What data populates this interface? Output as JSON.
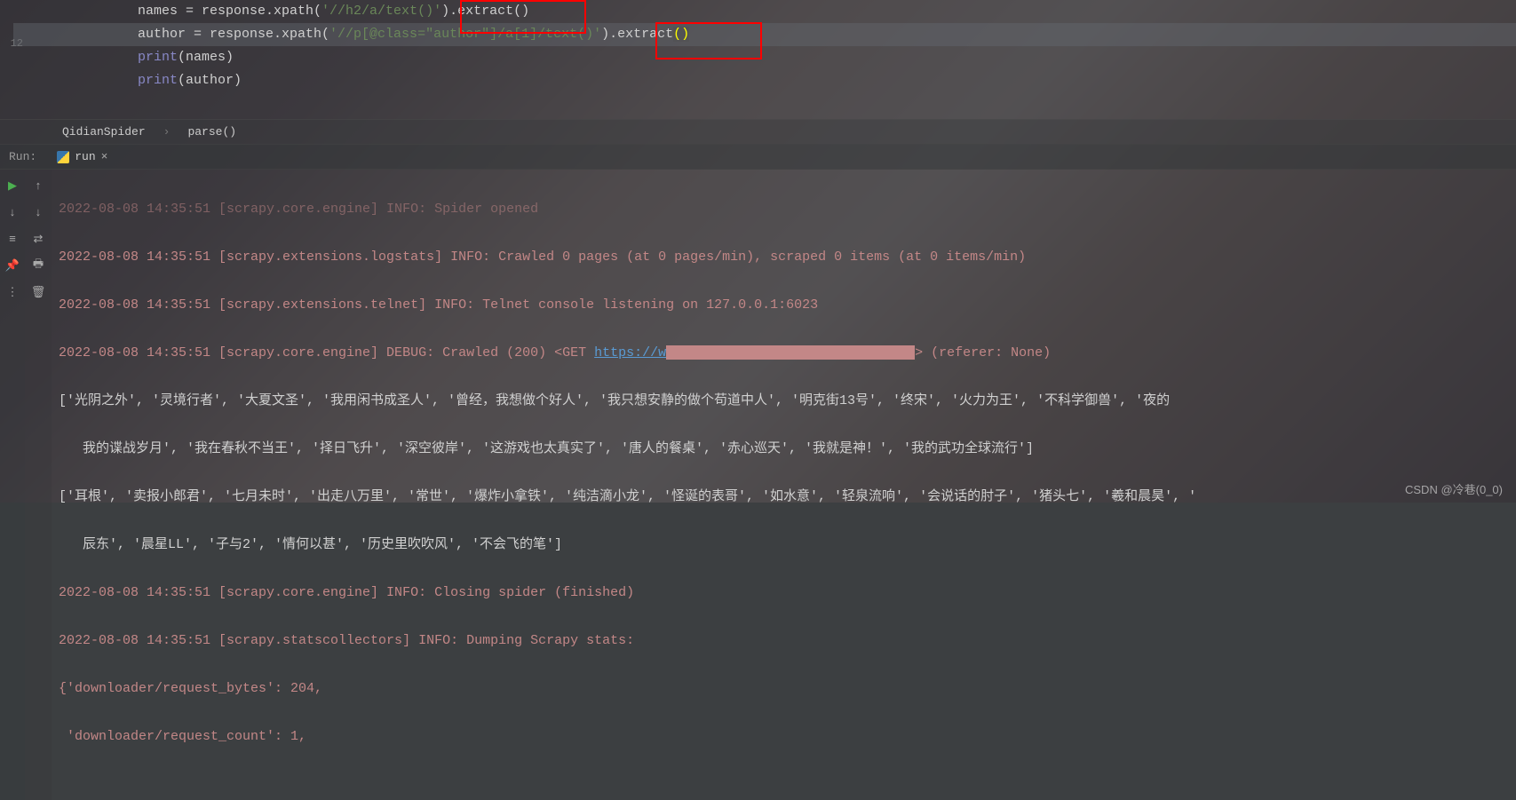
{
  "editor": {
    "gutter_line_12": "12",
    "line1": {
      "var": "names",
      "eq": " = response.xpath(",
      "str": "'//h2/a/text()'",
      "tail": ").extract()"
    },
    "line2": {
      "var": "author",
      "eq": " = response.xpath(",
      "str": "'//p[@class=\"author\"]/a[1]/text()'",
      "tail_a": ").extract",
      "paren_open": "(",
      "paren_close": ")"
    },
    "line3": {
      "print": "print",
      "args": "(names)"
    },
    "line4": {
      "print": "print",
      "args": "(author)"
    }
  },
  "breadcrumb": {
    "item1": "QidianSpider",
    "item2": "parse()"
  },
  "run": {
    "label": "Run:",
    "tab": "run",
    "close": "×"
  },
  "console": {
    "partial_top": "2022-08-08 14:35:51 [scrapy.core.engine] INFO: Spider opened",
    "l1": "2022-08-08 14:35:51 [scrapy.extensions.logstats] INFO: Crawled 0 pages (at 0 pages/min), scraped 0 items (at 0 items/min)",
    "l2": "2022-08-08 14:35:51 [scrapy.extensions.telnet] INFO: Telnet console listening on 127.0.0.1:6023",
    "l3_pre": "2022-08-08 14:35:51 [scrapy.core.engine] DEBUG: Crawled (200) <GET ",
    "l3_url": "https://w",
    "l3_post": "> (referer: None)",
    "names_list": "['光阴之外', '灵境行者', '大夏文圣', '我用闲书成圣人', '曾经，我想做个好人', '我只想安静的做个苟道中人', '明克街13号', '终宋', '火力为王', '不科学御兽', '夜的",
    "names_list2": "   我的谍战岁月', '我在春秋不当王', '择日飞升', '深空彼岸', '这游戏也太真实了', '唐人的餐桌', '赤心巡天', '我就是神！', '我的武功全球流行']",
    "author_list": "['耳根', '卖报小郎君', '七月未时', '出走八万里', '常世', '爆炸小拿铁', '纯洁滴小龙', '怪诞的表哥', '如水意', '轻泉流响', '会说话的肘子', '猪头七', '羲和晨昊', '",
    "author_list2": "   辰东', '晨星LL', '子与2', '情何以甚', '历史里吹吹风', '不会飞的笔']",
    "l4": "2022-08-08 14:35:51 [scrapy.core.engine] INFO: Closing spider (finished)",
    "l5": "2022-08-08 14:35:51 [scrapy.statscollectors] INFO: Dumping Scrapy stats:",
    "l6": "{'downloader/request_bytes': 204,",
    "l7": " 'downloader/request_count': 1,"
  },
  "watermark": "CSDN @冷巷(0_0)"
}
